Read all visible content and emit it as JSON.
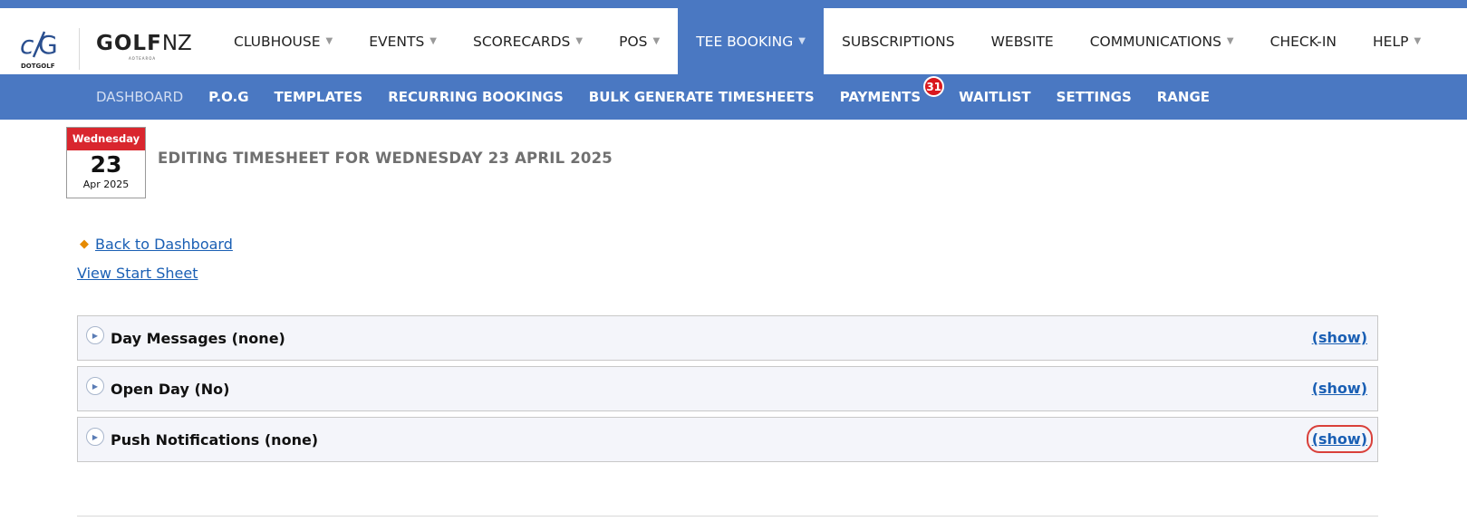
{
  "brand": {
    "dotgolf_label": "DOTGOLF",
    "golfnz_bold": "GOLF",
    "golfnz_light": "NZ",
    "golfnz_tagline": "AOTEAROA"
  },
  "nav": {
    "items": [
      {
        "label": "CLUBHOUSE",
        "dropdown": true
      },
      {
        "label": "EVENTS",
        "dropdown": true
      },
      {
        "label": "SCORECARDS",
        "dropdown": true
      },
      {
        "label": "POS",
        "dropdown": true
      },
      {
        "label": "TEE BOOKING",
        "dropdown": true,
        "active": true
      },
      {
        "label": "SUBSCRIPTIONS",
        "dropdown": false
      },
      {
        "label": "WEBSITE",
        "dropdown": false
      },
      {
        "label": "COMMUNICATIONS",
        "dropdown": true
      },
      {
        "label": "CHECK-IN",
        "dropdown": false
      },
      {
        "label": "HELP",
        "dropdown": true
      }
    ],
    "caret": "▼"
  },
  "subnav": {
    "items": [
      {
        "label": "DASHBOARD",
        "active": true
      },
      {
        "label": "P.O.G"
      },
      {
        "label": "TEMPLATES"
      },
      {
        "label": "RECURRING BOOKINGS"
      },
      {
        "label": "BULK GENERATE TIMESHEETS"
      },
      {
        "label": "PAYMENTS",
        "badge": "31"
      },
      {
        "label": "WAITLIST"
      },
      {
        "label": "SETTINGS"
      },
      {
        "label": "RANGE"
      }
    ]
  },
  "calendar": {
    "weekday": "Wednesday",
    "day": "23",
    "month_year": "Apr 2025"
  },
  "page": {
    "title": "EDITING TIMESHEET FOR WEDNESDAY 23 APRIL 2025",
    "back_link": "Back to Dashboard",
    "view_start_sheet": "View Start Sheet"
  },
  "panels": [
    {
      "title": "Day Messages (none)",
      "action": "(show)"
    },
    {
      "title": "Open Day (No)",
      "action": "(show)"
    },
    {
      "title": "Push Notifications (none)",
      "action": "(show)",
      "highlighted": true
    }
  ],
  "colors": {
    "primary": "#4a78c2",
    "badge": "#d9181e",
    "calendar_header": "#d9262e",
    "link": "#1a5fb4",
    "highlight": "#d9403a"
  }
}
